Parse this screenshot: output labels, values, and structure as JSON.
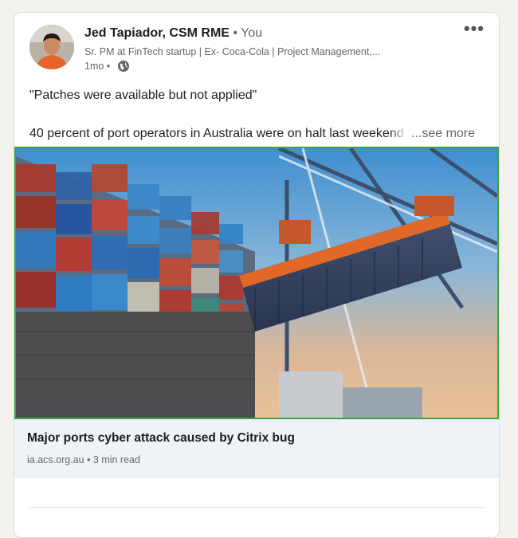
{
  "post": {
    "author_name": "Jed Tapiador, CSM RME",
    "connection_degree": "• You",
    "headline": "Sr. PM at FinTech startup | Ex- Coca-Cola | Project Management,...",
    "timestamp": "1mo •",
    "visibility_icon": "globe-icon",
    "menu_label": "•••",
    "text_line1": "\"Patches were available but not applied\"",
    "text_line2": "40 percent of port operators in Australia were on halt last weekend",
    "see_more_label": "...see more"
  },
  "article": {
    "title": "Major ports cyber attack caused by Citrix bug",
    "source": "ia.acs.org.au • 3 min read"
  },
  "colors": {
    "card_background": "#ffffff",
    "page_background": "#f3f2ef",
    "article_footer": "#eef3f8",
    "image_border": "#3fa33f"
  }
}
